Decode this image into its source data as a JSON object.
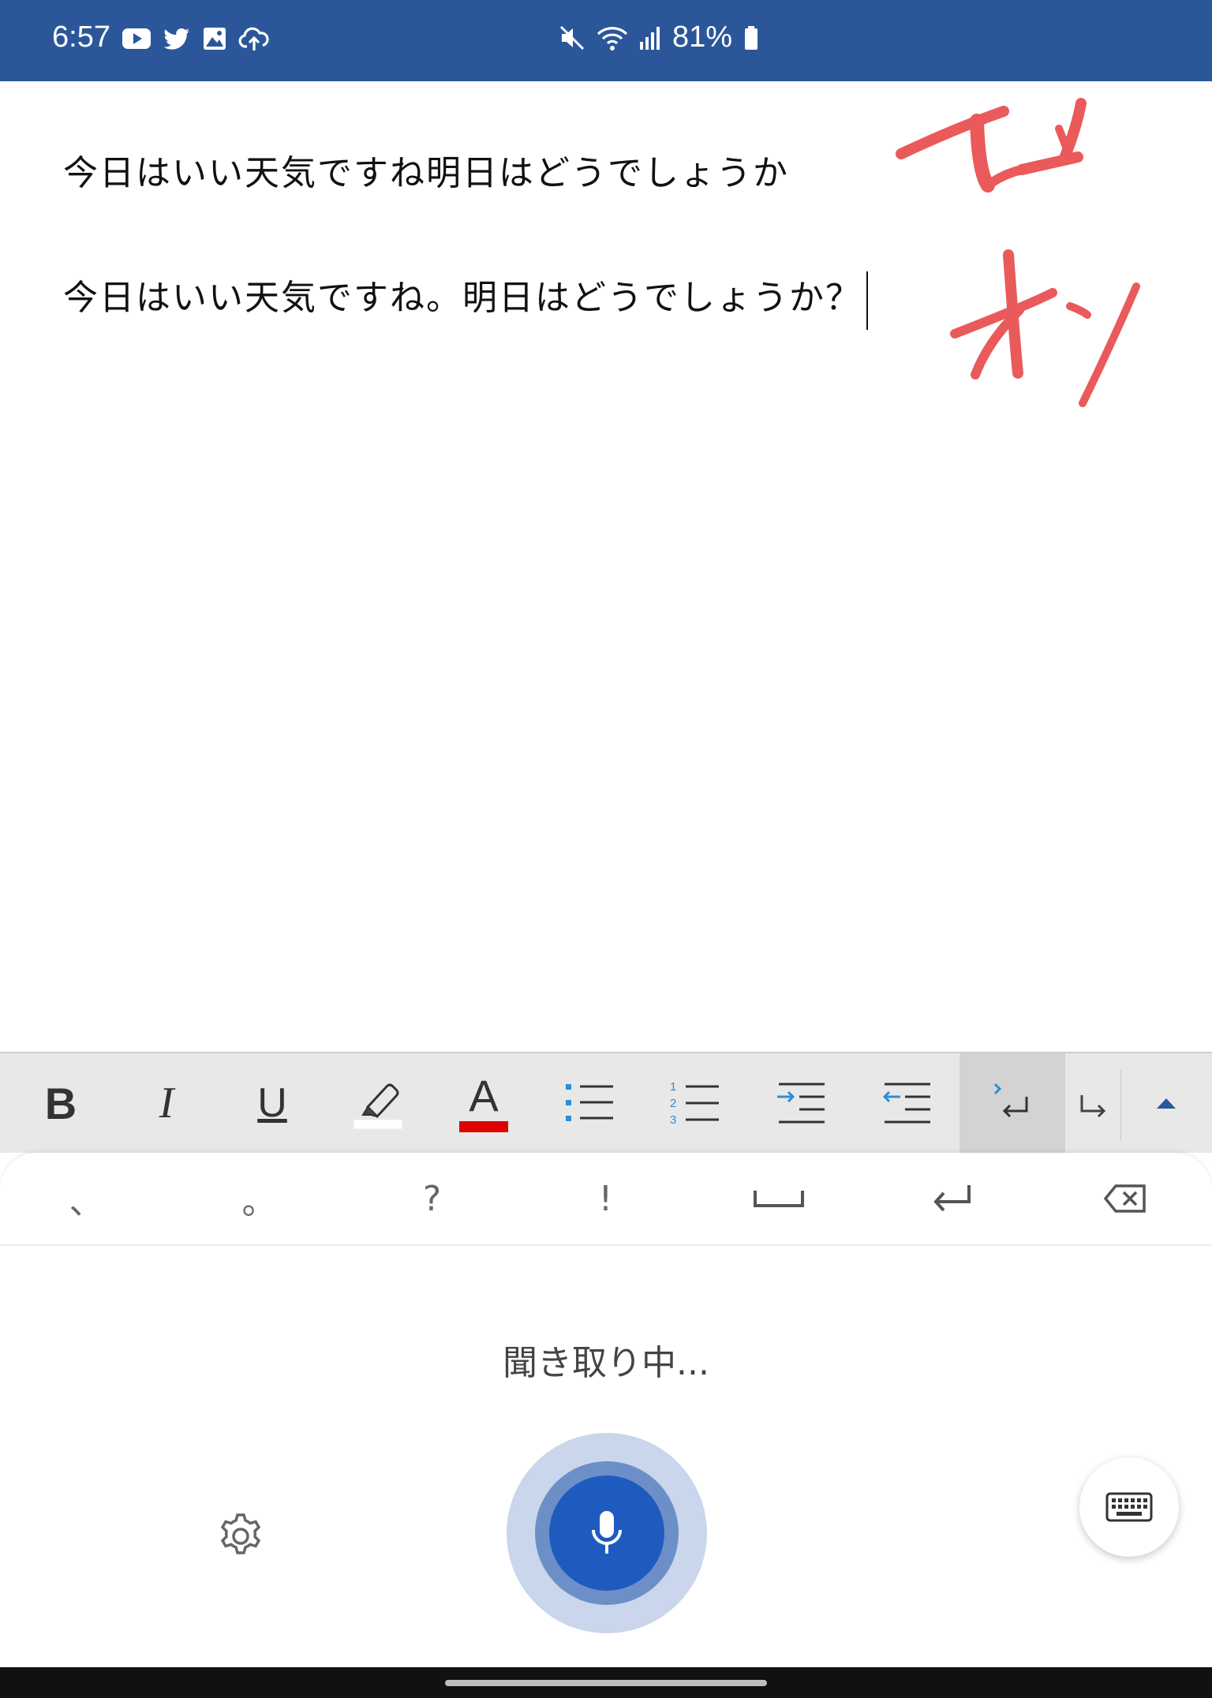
{
  "status_bar": {
    "time": "6:57",
    "left_icons": [
      "youtube-icon",
      "twitter-icon",
      "gallery-icon",
      "cloud-upload-icon"
    ],
    "right_icons": [
      "mute-icon",
      "wifi-icon",
      "signal-icon"
    ],
    "battery": "81%",
    "color": "#2b579a"
  },
  "document": {
    "line1": "今日はいい天気ですね明日はどうでしょうか",
    "line2": "今日はいい天気ですね。明日はどうでしょうか？"
  },
  "annotations": {
    "marks": [
      "handwritten-mark-1",
      "handwritten-mark-2"
    ],
    "color": "#ea5a5a"
  },
  "format_toolbar": {
    "bold_label": "B",
    "italic_label": "I",
    "underline_label": "U",
    "font_color_label": "A",
    "highlight_color": "#ffffff",
    "font_color": "#e00000",
    "accent": "#2b8fd6"
  },
  "punctuation_row": {
    "keys": [
      "、",
      "。",
      "?",
      "!"
    ],
    "icons": [
      "space-icon",
      "enter-icon",
      "backspace-icon"
    ]
  },
  "voice": {
    "status": "聞き取り中...",
    "mic_color": "#1f5bbf"
  }
}
